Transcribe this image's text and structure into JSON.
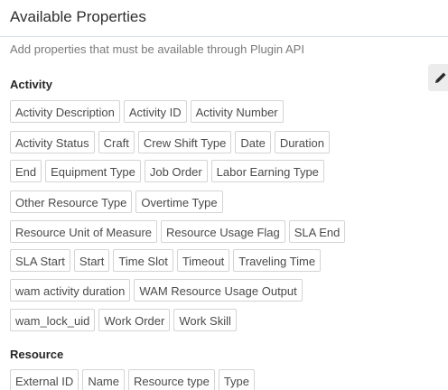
{
  "panel": {
    "title": "Available Properties",
    "subtitle": "Add properties that must be available through Plugin API",
    "edit_icon": "pencil-icon"
  },
  "sections": [
    {
      "title": "Activity",
      "rows": [
        [
          "Activity Description",
          "Activity ID",
          "Activity Number"
        ],
        [
          "Activity Status",
          "Craft",
          "Crew Shift Type",
          "Date",
          "Duration"
        ],
        [
          "End",
          "Equipment Type",
          "Job Order",
          "Labor Earning Type"
        ],
        [
          "Other Resource Type",
          "Overtime Type"
        ],
        [
          "Resource Unit of Measure",
          "Resource Usage Flag",
          "SLA End"
        ],
        [
          "SLA Start",
          "Start",
          "Time Slot",
          "Timeout",
          "Traveling Time"
        ],
        [
          "wam activity duration",
          "WAM Resource Usage Output"
        ],
        [
          "wam_lock_uid",
          "Work Order",
          "Work Skill"
        ]
      ]
    },
    {
      "title": "Resource",
      "rows": [
        [
          "External ID",
          "Name",
          "Resource type",
          "Type"
        ]
      ]
    }
  ]
}
